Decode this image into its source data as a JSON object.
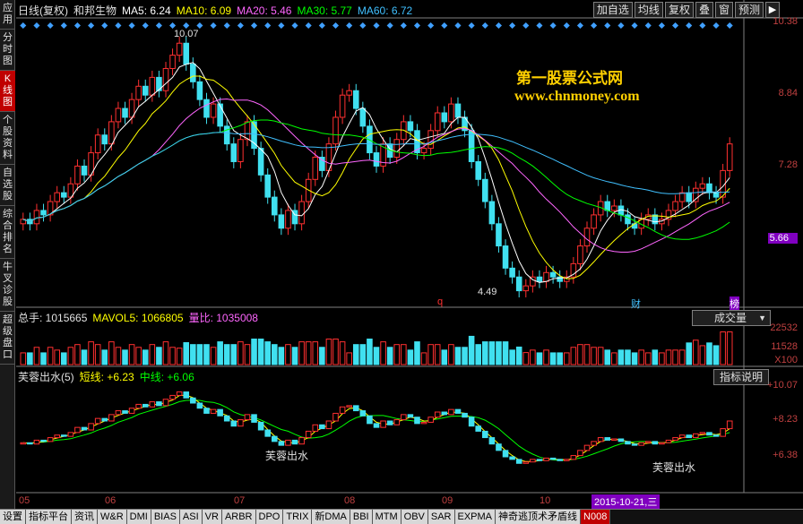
{
  "leftnav": [
    "应用",
    "分时图",
    "K线图",
    "个股资料",
    "自选股",
    "综合排名",
    "牛叉诊股",
    "超级盘口"
  ],
  "header": {
    "title": "日线(复权)",
    "stock": "和邦生物",
    "ma5": "MA5: 6.24",
    "ma10": "MA10: 6.09",
    "ma20": "MA20: 5.46",
    "ma30": "MA30: 5.77",
    "ma60": "MA60: 6.72"
  },
  "tools": [
    "加自选",
    "均线",
    "复权",
    "叠",
    "窗",
    "预测"
  ],
  "watermark": {
    "line1": "第一股票公式网",
    "line2": "www.chnmoney.com"
  },
  "price_axis": [
    "10.38",
    "8.84",
    "7.28",
    "5.66"
  ],
  "annotations": {
    "high": "10.07",
    "low": "4.49",
    "marker_q": "q",
    "marker_cai": "财",
    "marker_bang": "榜"
  },
  "volume": {
    "total": "总手: 1015665",
    "mavol": "MAVOL5: 1066805",
    "ratio": "量比: 1035008",
    "select_label": "成交量",
    "axis": [
      "22532",
      "11528",
      "X100"
    ]
  },
  "indicator": {
    "title": "芙蓉出水(5)",
    "short": "短线: +6.23",
    "mid": "中线: +6.06",
    "button": "指标说明",
    "axis": [
      "+10.07",
      "+8.23",
      "+6.38"
    ],
    "labels": [
      "芙蓉出水",
      "芙蓉出水"
    ]
  },
  "months": [
    "05",
    "06",
    "07",
    "08",
    "09",
    "10"
  ],
  "date_badge": "2015-10-21,三",
  "tabs": [
    "设置",
    "指标平台",
    "资讯",
    "W&R",
    "DMI",
    "BIAS",
    "ASI",
    "VR",
    "ARBR",
    "DPO",
    "TRIX",
    "新DMA",
    "BBI",
    "MTM",
    "OBV",
    "SAR",
    "EXPMA",
    "神奇逃顶术矛盾线",
    "N008"
  ],
  "colors": {
    "up": "#ff3030",
    "down": "#40e0f0",
    "ma5": "#ffffff",
    "ma10": "#ffff00",
    "ma20": "#ff66ff",
    "ma30": "#00ff00",
    "ma60": "#40c0ff"
  },
  "chart_data": {
    "type": "candlestick",
    "closes": [
      6.1,
      6.0,
      6.3,
      6.2,
      6.5,
      6.7,
      6.6,
      6.9,
      7.3,
      7.1,
      7.6,
      8.0,
      7.8,
      8.3,
      8.6,
      8.4,
      8.8,
      9.1,
      8.9,
      9.3,
      9.0,
      9.5,
      9.8,
      10.07,
      9.6,
      9.2,
      8.8,
      8.4,
      8.7,
      8.2,
      7.8,
      7.4,
      7.9,
      8.3,
      7.7,
      7.1,
      6.6,
      6.2,
      5.9,
      6.3,
      6.0,
      6.5,
      7.0,
      7.5,
      7.2,
      7.8,
      8.4,
      8.9,
      9.0,
      8.6,
      8.2,
      7.6,
      7.3,
      7.8,
      7.5,
      7.9,
      8.3,
      8.1,
      7.6,
      7.7,
      8.1,
      8.5,
      8.3,
      8.7,
      8.4,
      8.1,
      7.4,
      7.0,
      6.5,
      6.0,
      5.5,
      5.0,
      4.8,
      4.49,
      4.6,
      4.8,
      4.7,
      4.9,
      4.8,
      4.7,
      4.8,
      5.1,
      5.5,
      5.9,
      6.2,
      6.5,
      6.3,
      6.4,
      6.2,
      6.0,
      5.9,
      6.1,
      6.2,
      6.0,
      6.1,
      6.3,
      6.5,
      6.7,
      6.5,
      6.8,
      6.9,
      6.7,
      6.6,
      7.2,
      7.8
    ],
    "price_range": [
      4.3,
      10.6
    ]
  }
}
